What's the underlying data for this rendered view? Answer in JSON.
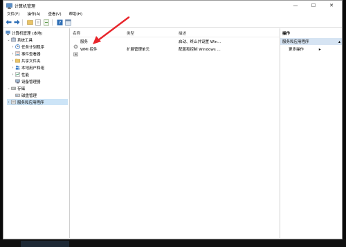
{
  "window": {
    "title": "计算机管理"
  },
  "controls": {
    "minimize": "—",
    "maximize": "☐",
    "close": "✕"
  },
  "menu": [
    "文件(F)",
    "操作(A)",
    "查看(V)",
    "帮助(H)"
  ],
  "toolbar": {
    "icons": [
      "back-arrow-icon",
      "forward-arrow-icon",
      "up-folder-icon",
      "properties-icon",
      "export-icon",
      "help-icon",
      "mmc-icon"
    ]
  },
  "tree": {
    "root": "计算机管理 (本地)",
    "system_tools": "系统工具",
    "task_scheduler": "任务计划程序",
    "event_viewer": "事件查看器",
    "shared_folders": "共享文件夹",
    "local_users": "本地用户和组",
    "performance": "性能",
    "device_manager": "设备管理器",
    "storage": "存储",
    "disk_management": "磁盘管理",
    "services_apps": "服务和应用程序"
  },
  "list": {
    "headers": {
      "name": "名称",
      "type": "类型",
      "desc": "描述"
    },
    "rows": [
      {
        "name": "服务",
        "type": "",
        "desc": "启动、终止并设置 Win..."
      },
      {
        "name": "WMI 控件",
        "type": "扩展管理单元",
        "desc": "配置和控制 Windows ..."
      }
    ]
  },
  "actions": {
    "header": "操作",
    "section": "服务和应用程序",
    "more": "更多操作"
  },
  "colors": {
    "selection": "#cce4f7",
    "section_bg": "#d6e4f3",
    "annotation_arrow": "#e8252b"
  }
}
